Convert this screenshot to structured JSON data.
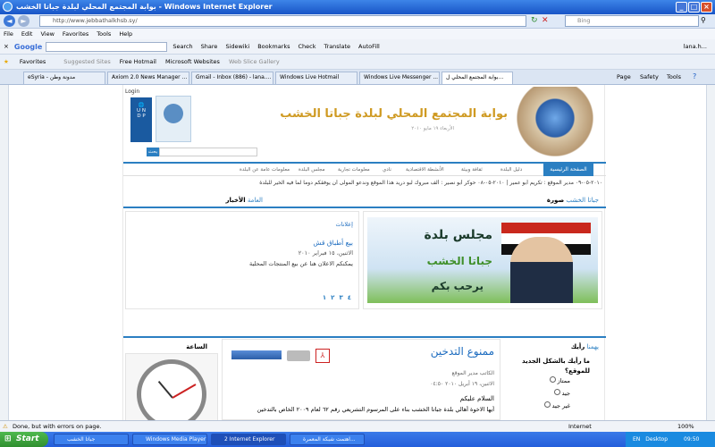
{
  "window": {
    "title": "بوابة المجتمع المحلي لبلدة جباتا الخشب - Windows Internet Explorer"
  },
  "address": {
    "url": "http://www.jebbathalkhsb.sy/",
    "search_placeholder": "Bing"
  },
  "menu": [
    "File",
    "Edit",
    "View",
    "Favorites",
    "Tools",
    "Help"
  ],
  "google_toolbar": {
    "brand": "Google",
    "items": [
      "Search",
      "Share",
      "Sidewiki",
      "Bookmarks",
      "Check",
      "Translate",
      "AutoFill"
    ],
    "user": "lana.h..."
  },
  "favorites_bar": {
    "label": "Favorites",
    "items": [
      "Suggested Sites",
      "Free Hotmail",
      "Microsoft Websites",
      "Web Slice Gallery"
    ]
  },
  "tabs": [
    "eSyria - مدونة وطن",
    "Axiom 2.0 News Manager ...",
    "Gmail - Inbox (886) - lana....",
    "Windows Live Hotmail",
    "Windows Live Messenger ...",
    "بوابة المجتمع المحلي ل..."
  ],
  "command_bar": {
    "items": [
      "Page",
      "Safety",
      "Tools"
    ]
  },
  "site": {
    "login": "Login",
    "header_title": "بوابة المجتمع المحلي لبلدة جباتا الخشب",
    "header_date": "الأربعاء ١٩ مايو ٢٠١٠",
    "search_button": "بحث",
    "nav": [
      "الصفحة الرئيسية",
      "دليل البلدة",
      "ثقافة وبيئة",
      "الأنشطة الاقتصادية",
      "نادي",
      "معلومات تجارية",
      "مجلس البلدة",
      "معلومات عامة عن البلدة"
    ],
    "ticker": "٢٠١٠-٠٥-٠٩ مدير الموقع : تكريم أبو عمير | ٢٠١٠-٠٥-٠٨ حوكر أبو نصير : ألف مبروك لبو دريد هذا الموقع وندعو المولى أن يوفقكم دوما لما فيه الخير للبلدة",
    "photo_heading_a": "صورة",
    "photo_heading_b": "جباتا الخشب",
    "news_heading_a": "الأخبار",
    "news_heading_b": "العامة",
    "banner_line1": "مجلس بلدة",
    "banner_line2": "جباتا الخشب",
    "banner_line3": "يرحب بكم",
    "ads_heading": "إعلانات",
    "ad_title": "بيع أطباق قش",
    "ad_date": "الاثنين، ١٥ فبراير ٢٠١٠",
    "ad_text": "يمكنكم الاعلان هنا عن بيع المنتجات المحلية",
    "pager": [
      "١",
      "٢",
      "٣",
      "٤"
    ],
    "poll_heading_a": "رأيك",
    "poll_heading_b": "يهمنا",
    "poll_question": "ما رأيك بالشكل الجديد للموقع؟",
    "poll_options": [
      "ممتاز",
      "جيد",
      "غير جيد"
    ],
    "clock_heading": "الساعة",
    "article_title": "ممنوع التدخين",
    "article_author": "الكاتب مدير الموقع",
    "article_date": "الاثنين، ١٩ أبريل ٢٠١٠ ٠٤:٥٠",
    "article_greeting": "السلام عليكم",
    "article_body": "أيها الاخوة أهالي بلدة جباتا الخشب بناء على المرسوم التشريعي رقم ٦٢ لعام ٢٠٠٩ الخاص بالتدخين"
  },
  "status": {
    "text": "Done, but with errors on page.",
    "zone": "Internet",
    "zoom": "100%"
  },
  "taskbar": {
    "start": "Start",
    "tasks": [
      "جباتا الخشب",
      "Windows Media Player",
      "2 Internet Explorer",
      "اهتمت شبكة المعمرة..."
    ],
    "lang": "EN",
    "desktop": "Desktop",
    "time": "09:50"
  }
}
